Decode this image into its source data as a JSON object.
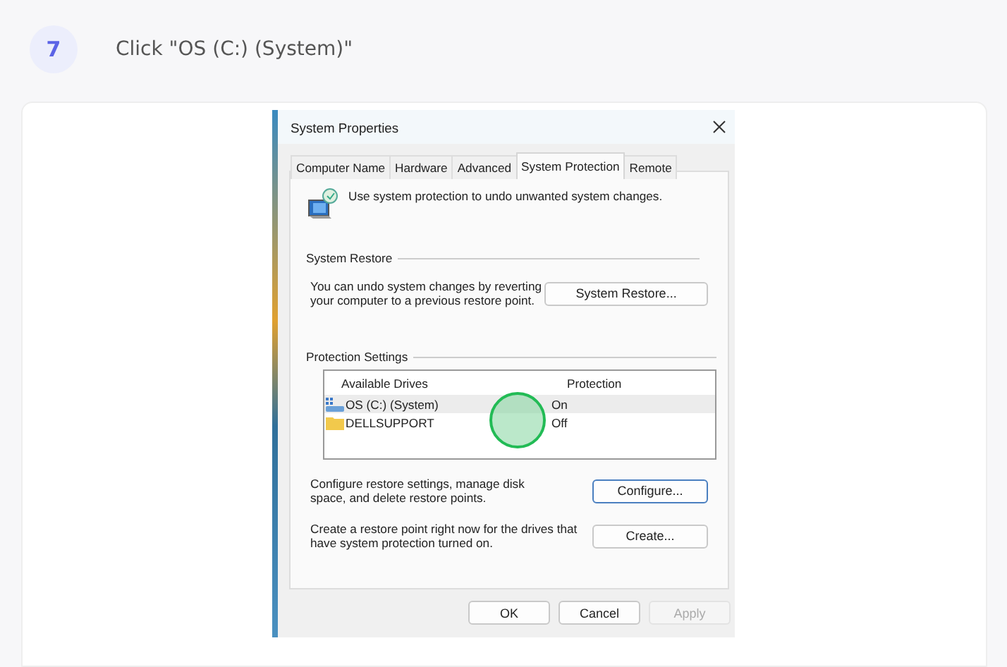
{
  "step": {
    "number": "7",
    "instruction": "Click \"OS (C:) (System)\""
  },
  "dialog": {
    "title": "System Properties",
    "tabs": [
      {
        "label": "Computer Name",
        "selected": false
      },
      {
        "label": "Hardware",
        "selected": false
      },
      {
        "label": "Advanced",
        "selected": false
      },
      {
        "label": "System Protection",
        "selected": true
      },
      {
        "label": "Remote",
        "selected": false
      }
    ],
    "intro": "Use system protection to undo unwanted system changes.",
    "system_restore": {
      "heading": "System Restore",
      "description": "You can undo system changes by reverting your computer to a previous restore point.",
      "button": "System Restore..."
    },
    "protection_settings": {
      "heading": "Protection Settings",
      "columns": [
        "Available Drives",
        "Protection"
      ],
      "drives": [
        {
          "kind": "system",
          "name": "OS (C:) (System)",
          "protection": "On",
          "selected": true
        },
        {
          "kind": "folder",
          "name": "DELLSUPPORT",
          "protection": "Off",
          "selected": false
        }
      ]
    },
    "configure": {
      "description": "Configure restore settings, manage disk space, and delete restore points.",
      "button": "Configure..."
    },
    "create": {
      "description": "Create a restore point right now for the drives that have system protection turned on.",
      "button": "Create..."
    },
    "buttons": [
      {
        "label": "OK",
        "disabled": false
      },
      {
        "label": "Cancel",
        "disabled": false
      },
      {
        "label": "Apply",
        "disabled": true
      }
    ]
  }
}
